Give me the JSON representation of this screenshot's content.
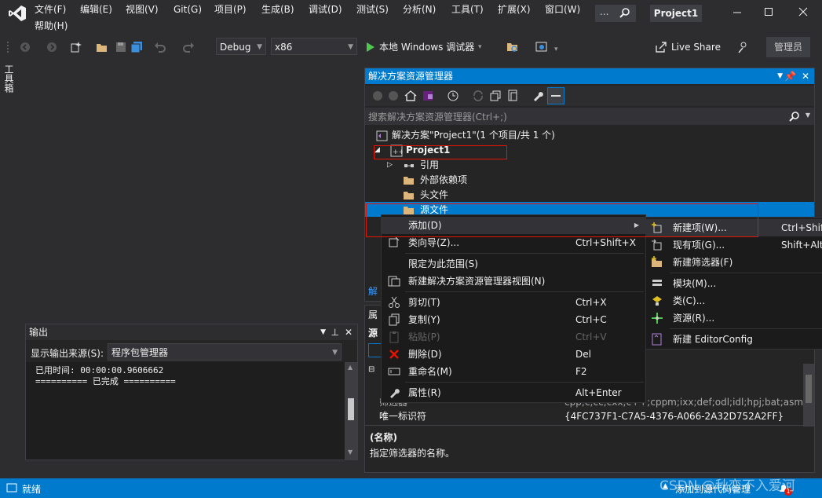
{
  "menubar": {
    "items": [
      "文件(F)",
      "编辑(E)",
      "视图(V)",
      "Git(G)",
      "项目(P)",
      "生成(B)",
      "调试(D)",
      "测试(S)",
      "分析(N)",
      "工具(T)",
      "扩展(X)",
      "窗口(W)"
    ],
    "help": "帮助(H)",
    "search_placeholder": "...",
    "project_badge": "Project1"
  },
  "toolbar": {
    "config": "Debug",
    "platform": "x86",
    "run_label": "本地 Windows 调试器",
    "live_share": "Live Share",
    "admin": "管理员"
  },
  "left_strip": {
    "toolbox": "工具箱"
  },
  "solution_explorer": {
    "title": "解决方案资源管理器",
    "search_placeholder": "搜索解决方案资源管理器(Ctrl+;)",
    "solution_label": "解决方案\"Project1\"(1 个项目/共 1 个)",
    "project": "Project1",
    "items": [
      "引用",
      "外部依赖项",
      "头文件",
      "源文件"
    ],
    "footer_partial": "解"
  },
  "properties": {
    "title_partial": "属",
    "subject_partial": "源",
    "rows": [
      {
        "name": "筛选器",
        "value": "cpp;c;cc;cxx;c++;cppm;ixx;def;odl;idl;hpj;bat;asm;asm"
      },
      {
        "name": "唯一标识符",
        "value": "{4FC737F1-C7A5-4376-A066-2A32D752A2FF}"
      }
    ],
    "desc_title": "(名称)",
    "desc_text": "指定筛选器的名称。"
  },
  "output": {
    "title": "输出",
    "source_label": "显示输出来源(S):",
    "source_value": "程序包管理器",
    "line1": "已用时间: 00:00:00.9606662",
    "line2": "========== 已完成 =========="
  },
  "context_menu": {
    "items": [
      {
        "label": "添加(D)",
        "shortcut": "",
        "submenu": true
      },
      {
        "label": "类向导(Z)...",
        "shortcut": "Ctrl+Shift+X"
      },
      {
        "label": "限定为此范围(S)",
        "shortcut": ""
      },
      {
        "label": "新建解决方案资源管理器视图(N)",
        "shortcut": ""
      },
      {
        "label": "剪切(T)",
        "shortcut": "Ctrl+X"
      },
      {
        "label": "复制(Y)",
        "shortcut": "Ctrl+C"
      },
      {
        "label": "粘贴(P)",
        "shortcut": "Ctrl+V",
        "disabled": true
      },
      {
        "label": "删除(D)",
        "shortcut": "Del"
      },
      {
        "label": "重命名(M)",
        "shortcut": "F2"
      },
      {
        "label": "属性(R)",
        "shortcut": "Alt+Enter"
      }
    ]
  },
  "submenu": {
    "items": [
      {
        "label": "新建项(W)...",
        "shortcut": "Ctrl+Shif"
      },
      {
        "label": "现有项(G)...",
        "shortcut": "Shift+Alt+"
      },
      {
        "label": "新建筛选器(F)",
        "shortcut": ""
      },
      {
        "label": "模块(M)...",
        "shortcut": ""
      },
      {
        "label": "类(C)...",
        "shortcut": ""
      },
      {
        "label": "资源(R)...",
        "shortcut": ""
      },
      {
        "label": "新建 EditorConfig",
        "shortcut": ""
      }
    ]
  },
  "statusbar": {
    "ready": "就绪",
    "source_control": "添加到源代码管理",
    "badge": "1"
  },
  "watermark": "CSDN @秋恋不入爱河",
  "colors": {
    "accent": "#007acc",
    "highlight": "#3399ff",
    "selection": "#007acc",
    "red_outline": "#e51400"
  }
}
